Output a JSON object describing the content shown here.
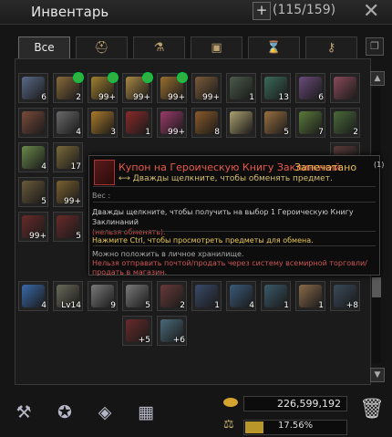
{
  "window": {
    "title": "Инвентарь",
    "slot_count": "(115/159)",
    "plus_icon": "plus-icon",
    "close_icon": "close-icon"
  },
  "tabs": [
    {
      "label": "Все",
      "icon": ""
    },
    {
      "label": "",
      "icon": "helmet-icon"
    },
    {
      "label": "",
      "icon": "potion-icon"
    },
    {
      "label": "",
      "icon": "chest-icon"
    },
    {
      "label": "",
      "icon": "hourglass-icon"
    },
    {
      "label": "",
      "icon": "key-icon"
    }
  ],
  "inventory": {
    "items": [
      {
        "count": "6",
        "badge": false
      },
      {
        "count": "2",
        "badge": true
      },
      {
        "count": "99+",
        "badge": true
      },
      {
        "count": "99+",
        "badge": true
      },
      {
        "count": "99+",
        "badge": true
      },
      {
        "count": "99+",
        "badge": false
      },
      {
        "count": "1",
        "badge": false
      },
      {
        "count": "13",
        "badge": false
      },
      {
        "count": "6",
        "badge": false
      },
      {
        "count": "",
        "badge": false
      },
      {
        "count": "",
        "badge": false
      },
      {
        "count": "4",
        "badge": false
      },
      {
        "count": "3",
        "badge": false
      },
      {
        "count": "1",
        "badge": false
      },
      {
        "count": "99+",
        "badge": false
      },
      {
        "count": "8",
        "badge": false
      },
      {
        "count": "",
        "badge": false
      },
      {
        "count": "5",
        "badge": false
      },
      {
        "count": "7",
        "badge": false
      },
      {
        "count": "2",
        "badge": false
      },
      {
        "count": "4",
        "badge": false
      },
      {
        "count": "17",
        "badge": false
      },
      {
        "count": "5",
        "badge": false
      },
      {
        "count": "99+",
        "badge": false
      },
      {
        "count": "99+",
        "badge": false
      },
      {
        "count": "5",
        "badge": false
      },
      {
        "count": "4",
        "badge": false
      },
      {
        "count": "Lv14",
        "badge": false
      },
      {
        "count": "9",
        "badge": false
      },
      {
        "count": "5",
        "badge": false
      },
      {
        "count": "2",
        "badge": false
      },
      {
        "count": "1",
        "badge": false
      },
      {
        "count": "4",
        "badge": false
      },
      {
        "count": "1",
        "badge": false
      },
      {
        "count": "1",
        "badge": false
      },
      {
        "count": "+8",
        "badge": false
      },
      {
        "count": "+5",
        "badge": false
      },
      {
        "count": "+6",
        "badge": false
      },
      {
        "count": "",
        "badge": false
      }
    ]
  },
  "tooltip": {
    "name": "Купон на Героическую Книгу Заклинаний",
    "sealed": "Запечатано",
    "seal_count": "(1)",
    "action": "⟷ Дважды щелкните, чтобы обменять предмет.",
    "weight": "Вес :",
    "description": "Дважды щелкните, чтобы получить на выбор 1 Героическую Книгу Заклинаний",
    "not_exchangeable": "(нельзя обменять).",
    "ctrl_hint": "Нажмите Ctrl, чтобы просмотреть предметы для обмена.",
    "storage_note": "Можно положить в личное хранилище.",
    "restriction_note": "Нельзя отправить почтой/продать через систему всемирной торговли/продать в магазин."
  },
  "bottom_bar": {
    "icons": [
      "anvil-icon",
      "enchant-icon",
      "extract-icon",
      "box-icon"
    ],
    "gold": "226,599,192",
    "weight_percent": "17.56%",
    "weight_fraction": 0.1756,
    "trash_icon": "trash-icon"
  },
  "colors": {
    "item_name": "#e85a4a",
    "sealed": "#e8c050",
    "ctrl_hint": "#e8c85a",
    "gold": "#d4a530",
    "not_exchangeable": "#d24c4c"
  }
}
